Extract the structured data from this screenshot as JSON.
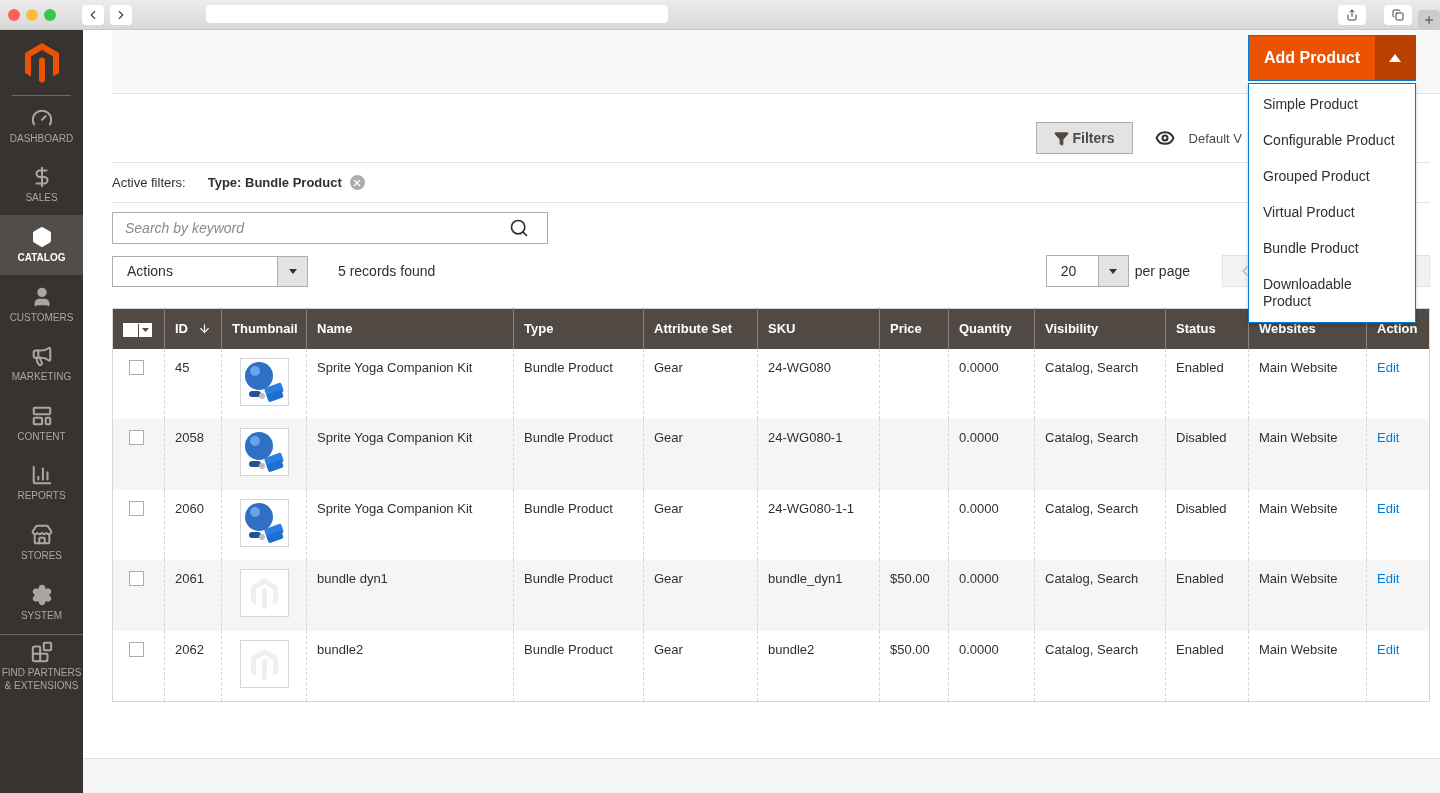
{
  "sidebar": {
    "items": [
      {
        "kind": "dashboard",
        "label": "DASHBOARD",
        "selected": false
      },
      {
        "kind": "sales",
        "label": "SALES",
        "selected": false
      },
      {
        "kind": "catalog",
        "label": "CATALOG",
        "selected": true
      },
      {
        "kind": "customers",
        "label": "CUSTOMERS",
        "selected": false
      },
      {
        "kind": "marketing",
        "label": "MARKETING",
        "selected": false
      },
      {
        "kind": "content",
        "label": "CONTENT",
        "selected": false
      },
      {
        "kind": "reports",
        "label": "REPORTS",
        "selected": false
      },
      {
        "kind": "stores",
        "label": "STORES",
        "selected": false
      },
      {
        "kind": "system",
        "label": "SYSTEM",
        "selected": false
      },
      {
        "kind": "partners",
        "label": "FIND PARTNERS & EXTENSIONS",
        "selected": false
      }
    ]
  },
  "add_product": {
    "label": "Add Product",
    "expanded": true,
    "menu": [
      "Simple Product",
      "Configurable Product",
      "Grouped Product",
      "Virtual Product",
      "Bundle Product",
      "Downloadable Product"
    ]
  },
  "toolbar": {
    "filters": "Filters",
    "view": "Default V"
  },
  "active_filters": {
    "label": "Active filters:",
    "filter": "Type: Bundle Product"
  },
  "search": {
    "placeholder": "Search by keyword"
  },
  "actions": {
    "label": "Actions",
    "records": "5 records found"
  },
  "paging": {
    "per_page_value": "20",
    "per_page_label": "per page"
  },
  "table": {
    "columns": [
      "ID",
      "Thumbnail",
      "Name",
      "Type",
      "Attribute Set",
      "SKU",
      "Price",
      "Quantity",
      "Visibility",
      "Status",
      "Websites",
      "Action"
    ],
    "rows": [
      {
        "checked": false,
        "id": "45",
        "name": "Sprite Yoga Companion Kit",
        "type": "Bundle Product",
        "attribute_set": "Gear",
        "sku": "24-WG080",
        "price": "",
        "quantity": "0.0000",
        "visibility": "Catalog, Search",
        "status": "Enabled",
        "websites": "Main Website",
        "action": "Edit"
      },
      {
        "checked": false,
        "id": "2058",
        "name": "Sprite Yoga Companion Kit",
        "type": "Bundle Product",
        "attribute_set": "Gear",
        "sku": "24-WG080-1",
        "price": "",
        "quantity": "0.0000",
        "visibility": "Catalog, Search",
        "status": "Disabled",
        "websites": "Main Website",
        "action": "Edit"
      },
      {
        "checked": false,
        "id": "2060",
        "name": "Sprite Yoga Companion Kit",
        "type": "Bundle Product",
        "attribute_set": "Gear",
        "sku": "24-WG080-1-1",
        "price": "",
        "quantity": "0.0000",
        "visibility": "Catalog, Search",
        "status": "Disabled",
        "websites": "Main Website",
        "action": "Edit"
      },
      {
        "checked": false,
        "id": "2061",
        "thumbnail": {
          "kind": "placeholder"
        },
        "name": "bundle dyn1",
        "type": "Bundle Product",
        "attribute_set": "Gear",
        "sku": "bundle_dyn1",
        "price": "$50.00",
        "quantity": "0.0000",
        "visibility": "Catalog, Search",
        "status": "Enabled",
        "websites": "Main Website",
        "action": "Edit"
      },
      {
        "checked": false,
        "id": "2062",
        "thumbnail": {
          "kind": "placeholder"
        },
        "name": "bundle2",
        "type": "Bundle Product",
        "attribute_set": "Gear",
        "sku": "bundle2",
        "price": "$50.00",
        "quantity": "0.0000",
        "visibility": "Catalog, Search",
        "status": "Enabled",
        "websites": "Main Website",
        "action": "Edit"
      }
    ]
  }
}
